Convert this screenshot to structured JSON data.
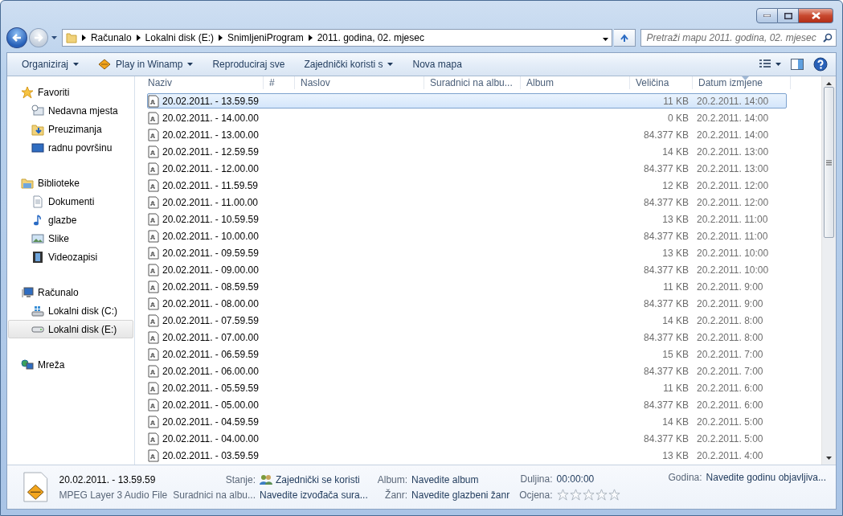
{
  "breadcrumb": [
    "Računalo",
    "Lokalni disk (E:)",
    "SnimljeniProgram",
    "2011. godina, 02. mjesec"
  ],
  "search": {
    "placeholder": "Pretraži mapu 2011. godina, 02. mjesec"
  },
  "toolbar": [
    {
      "label": "Organiziraj",
      "kind": "plain",
      "dropdown": true
    },
    {
      "label": "Play in Winamp",
      "kind": "winamp",
      "dropdown": true
    },
    {
      "label": "Reproduciraj sve",
      "kind": "plain",
      "dropdown": false
    },
    {
      "label": "Zajednički koristi s",
      "kind": "plain",
      "dropdown": true
    },
    {
      "label": "Nova mapa",
      "kind": "plain",
      "dropdown": false
    }
  ],
  "sidebar": [
    {
      "label": "Favoriti",
      "kind": "star",
      "selected": false,
      "children": [
        {
          "label": "Nedavna mjesta",
          "kind": "recent",
          "selected": false
        },
        {
          "label": "Preuzimanja",
          "kind": "download",
          "selected": false
        },
        {
          "label": "radnu površinu",
          "kind": "desktop",
          "selected": false
        }
      ]
    },
    {
      "label": "Biblioteke",
      "kind": "library",
      "selected": false,
      "children": [
        {
          "label": "Dokumenti",
          "kind": "document",
          "selected": false
        },
        {
          "label": "glazbe",
          "kind": "music",
          "selected": false
        },
        {
          "label": "Slike",
          "kind": "pictures",
          "selected": false
        },
        {
          "label": "Videozapisi",
          "kind": "video",
          "selected": false
        }
      ]
    },
    {
      "label": "Računalo",
      "kind": "computer",
      "selected": false,
      "children": [
        {
          "label": "Lokalni disk (C:)",
          "kind": "systemdrive",
          "selected": false
        },
        {
          "label": "Lokalni disk (E:)",
          "kind": "drive",
          "selected": true
        }
      ]
    },
    {
      "label": "Mreža",
      "kind": "network",
      "selected": false
    }
  ],
  "table": {
    "columns": [
      {
        "label": "Naziv",
        "sorted": false
      },
      {
        "label": "#",
        "sorted": false
      },
      {
        "label": "Naslov",
        "sorted": false
      },
      {
        "label": "Suradnici na albu...",
        "sorted": false
      },
      {
        "label": "Album",
        "sorted": false
      },
      {
        "label": "Veličina",
        "sorted": false
      },
      {
        "label": "Datum izmjene",
        "sorted": true
      }
    ],
    "rows": [
      {
        "name": "20.02.2011. - 13.59.59",
        "size": "11 KB",
        "date": "20.2.2011. 14:00",
        "selected": true
      },
      {
        "name": "20.02.2011. - 14.00.00",
        "size": "0 KB",
        "date": "20.2.2011. 14:00",
        "selected": false
      },
      {
        "name": "20.02.2011. - 13.00.00",
        "size": "84.377 KB",
        "date": "20.2.2011. 14:00",
        "selected": false
      },
      {
        "name": "20.02.2011. - 12.59.59",
        "size": "14 KB",
        "date": "20.2.2011. 13:00",
        "selected": false
      },
      {
        "name": "20.02.2011. - 12.00.00",
        "size": "84.377 KB",
        "date": "20.2.2011. 13:00",
        "selected": false
      },
      {
        "name": "20.02.2011. - 11.59.59",
        "size": "12 KB",
        "date": "20.2.2011. 12:00",
        "selected": false
      },
      {
        "name": "20.02.2011. - 11.00.00",
        "size": "84.377 KB",
        "date": "20.2.2011. 12:00",
        "selected": false
      },
      {
        "name": "20.02.2011. - 10.59.59",
        "size": "13 KB",
        "date": "20.2.2011. 11:00",
        "selected": false
      },
      {
        "name": "20.02.2011. - 10.00.00",
        "size": "84.377 KB",
        "date": "20.2.2011. 11:00",
        "selected": false
      },
      {
        "name": "20.02.2011. - 09.59.59",
        "size": "13 KB",
        "date": "20.2.2011. 10:00",
        "selected": false
      },
      {
        "name": "20.02.2011. - 09.00.00",
        "size": "84.377 KB",
        "date": "20.2.2011. 10:00",
        "selected": false
      },
      {
        "name": "20.02.2011. - 08.59.59",
        "size": "11 KB",
        "date": "20.2.2011. 9:00",
        "selected": false
      },
      {
        "name": "20.02.2011. - 08.00.00",
        "size": "84.377 KB",
        "date": "20.2.2011. 9:00",
        "selected": false
      },
      {
        "name": "20.02.2011. - 07.59.59",
        "size": "14 KB",
        "date": "20.2.2011. 8:00",
        "selected": false
      },
      {
        "name": "20.02.2011. - 07.00.00",
        "size": "84.377 KB",
        "date": "20.2.2011. 8:00",
        "selected": false
      },
      {
        "name": "20.02.2011. - 06.59.59",
        "size": "15 KB",
        "date": "20.2.2011. 7:00",
        "selected": false
      },
      {
        "name": "20.02.2011. - 06.00.00",
        "size": "84.377 KB",
        "date": "20.2.2011. 7:00",
        "selected": false
      },
      {
        "name": "20.02.2011. - 05.59.59",
        "size": "11 KB",
        "date": "20.2.2011. 6:00",
        "selected": false
      },
      {
        "name": "20.02.2011. - 05.00.00",
        "size": "84.377 KB",
        "date": "20.2.2011. 6:00",
        "selected": false
      },
      {
        "name": "20.02.2011. - 04.59.59",
        "size": "14 KB",
        "date": "20.2.2011. 5:00",
        "selected": false
      },
      {
        "name": "20.02.2011. - 04.00.00",
        "size": "84.377 KB",
        "date": "20.2.2011. 5:00",
        "selected": false
      },
      {
        "name": "20.02.2011. - 03.59.59",
        "size": "13 KB",
        "date": "20.2.2011. 4:00",
        "selected": false
      }
    ]
  },
  "details": {
    "name": "20.02.2011. - 13.59.59",
    "type": "MPEG Layer 3 Audio File",
    "columns": [
      [
        {
          "label": "Stanje:",
          "kind": "status",
          "value": "Zajednički se koristi"
        },
        {
          "label": "Suradnici na albu...",
          "kind": "text",
          "value": "Navedite izvođača sura..."
        }
      ],
      [
        {
          "label": "Album:",
          "kind": "text",
          "value": "Navedite album"
        },
        {
          "label": "Žanr:",
          "kind": "text",
          "value": "Navedite glazbeni žanr"
        }
      ],
      [
        {
          "label": "Duljina:",
          "kind": "text",
          "value": "00:00:00"
        },
        {
          "label": "Ocjena:",
          "kind": "rating",
          "stars": 0
        }
      ],
      [
        {
          "label": "Godina:",
          "kind": "text",
          "value": "Navedite godinu objavljiva..."
        }
      ]
    ]
  }
}
